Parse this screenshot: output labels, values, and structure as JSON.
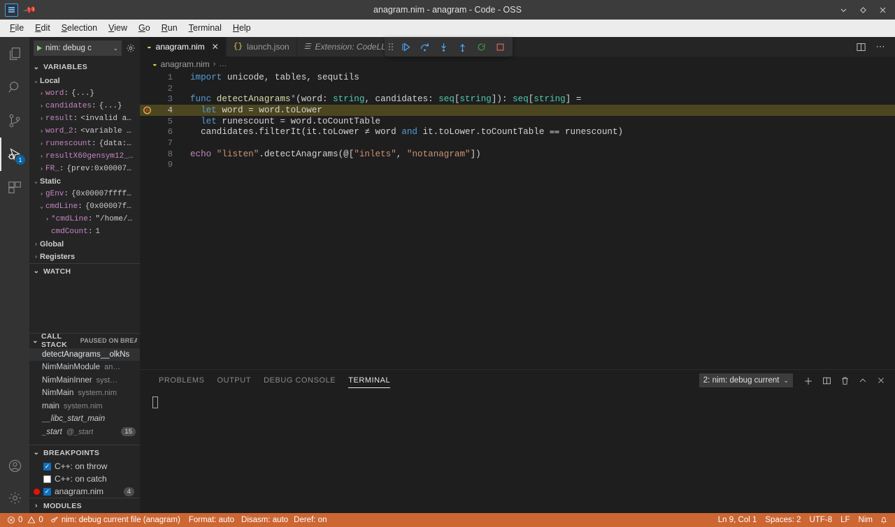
{
  "titlebar": {
    "title": "anagram.nim - anagram - Code - OSS",
    "logo_icon": "vscode-logo-icon",
    "pin_icon": "pin-icon",
    "minimize_icon": "chevron-down-icon",
    "maximize_icon": "diamond-restore-icon",
    "close_icon": "close-icon"
  },
  "menubar": {
    "items": [
      {
        "label": "File",
        "mnemonic": "F"
      },
      {
        "label": "Edit",
        "mnemonic": "E"
      },
      {
        "label": "Selection",
        "mnemonic": "S"
      },
      {
        "label": "View",
        "mnemonic": "V"
      },
      {
        "label": "Go",
        "mnemonic": "G"
      },
      {
        "label": "Run",
        "mnemonic": "R"
      },
      {
        "label": "Terminal",
        "mnemonic": "T"
      },
      {
        "label": "Help",
        "mnemonic": "H"
      }
    ]
  },
  "activitybar": {
    "items": [
      {
        "name": "explorer",
        "icon": "files-icon",
        "active": false,
        "badge": ""
      },
      {
        "name": "search",
        "icon": "search-icon",
        "active": false,
        "badge": ""
      },
      {
        "name": "source-control",
        "icon": "source-control-icon",
        "active": false,
        "badge": ""
      },
      {
        "name": "run-and-debug",
        "icon": "run-and-debug-icon",
        "active": true,
        "badge": "1"
      },
      {
        "name": "extensions",
        "icon": "extensions-icon",
        "active": false,
        "badge": ""
      }
    ],
    "bottom": [
      {
        "name": "accounts",
        "icon": "account-icon"
      },
      {
        "name": "manage",
        "icon": "gear-icon"
      }
    ]
  },
  "sidebar": {
    "launch_config": "nim: debug c",
    "launch_play_icon": "play-icon",
    "launch_chevron_icon": "chevron-down-icon",
    "gear_icon": "gear-icon",
    "variables": {
      "title": "VARIABLES",
      "rows": [
        {
          "indent": 1,
          "caret": "down",
          "name": "Local",
          "sep": "",
          "value": "",
          "group": true
        },
        {
          "indent": 2,
          "caret": "right",
          "name": "word",
          "sep": ":",
          "value": "{...}",
          "group": false
        },
        {
          "indent": 2,
          "caret": "right",
          "name": "candidates",
          "sep": ":",
          "value": "{...}",
          "group": false
        },
        {
          "indent": 2,
          "caret": "right",
          "name": "result",
          "sep": ":",
          "value": "<invalid a…",
          "group": false
        },
        {
          "indent": 2,
          "caret": "right",
          "name": "word_2",
          "sep": ":",
          "value": "<variable …",
          "group": false
        },
        {
          "indent": 2,
          "caret": "right",
          "name": "runescount",
          "sep": ":",
          "value": "{data:…",
          "group": false
        },
        {
          "indent": 2,
          "caret": "right",
          "name": "resultX60gensym12_…",
          "sep": "",
          "value": "",
          "group": false
        },
        {
          "indent": 2,
          "caret": "right",
          "name": "FR_",
          "sep": ":",
          "value": "{prev:0x00007…",
          "group": false
        },
        {
          "indent": 1,
          "caret": "down",
          "name": "Static",
          "sep": "",
          "value": "",
          "group": true
        },
        {
          "indent": 2,
          "caret": "right",
          "name": "gEnv",
          "sep": ":",
          "value": "{0x00007ffff…",
          "group": false
        },
        {
          "indent": 2,
          "caret": "down",
          "name": "cmdLine",
          "sep": ":",
          "value": "{0x00007f…",
          "group": false
        },
        {
          "indent": 3,
          "caret": "right",
          "name": "*cmdLine",
          "sep": ":",
          "value": "\"/home/…",
          "group": false
        },
        {
          "indent": 3,
          "caret": "none",
          "name": "cmdCount",
          "sep": ":",
          "value": "1",
          "group": false,
          "numeric": true
        },
        {
          "indent": 1,
          "caret": "right",
          "name": "Global",
          "sep": "",
          "value": "",
          "group": true
        },
        {
          "indent": 1,
          "caret": "right",
          "name": "Registers",
          "sep": "",
          "value": "",
          "group": true
        }
      ]
    },
    "watch": {
      "title": "WATCH"
    },
    "callstack": {
      "title": "CALL STACK",
      "subtitle": "PAUSED ON BREAKPOI",
      "frames": [
        {
          "fn": "detectAnagrams__olkNs",
          "src": "",
          "count": "",
          "selected": true,
          "italic": false
        },
        {
          "fn": "NimMainModule",
          "src": "an…",
          "count": "",
          "selected": false,
          "italic": false
        },
        {
          "fn": "NimMainInner",
          "src": "syst…",
          "count": "",
          "selected": false,
          "italic": false
        },
        {
          "fn": "NimMain",
          "src": "system.nim",
          "count": "",
          "selected": false,
          "italic": false
        },
        {
          "fn": "main",
          "src": "system.nim",
          "count": "",
          "selected": false,
          "italic": false
        },
        {
          "fn": "__libc_start_main",
          "src": "",
          "count": "",
          "selected": false,
          "italic": true
        },
        {
          "fn": "_start",
          "src": "@_start",
          "count": "15",
          "selected": false,
          "italic": true
        }
      ]
    },
    "breakpoints": {
      "title": "BREAKPOINTS",
      "items": [
        {
          "label": "C++: on throw",
          "checked": true,
          "dot": false,
          "count": ""
        },
        {
          "label": "C++: on catch",
          "checked": false,
          "dot": false,
          "count": ""
        },
        {
          "label": "anagram.nim",
          "checked": true,
          "dot": true,
          "count": "4"
        }
      ]
    },
    "modules": {
      "title": "MODULES"
    }
  },
  "editor": {
    "tabs": [
      {
        "label": "anagram.nim",
        "icon": "nim-file-icon",
        "active": true,
        "italic": false,
        "closable": true
      },
      {
        "label": "launch.json",
        "icon": "json-file-icon",
        "active": false,
        "italic": false,
        "closable": false
      },
      {
        "label": "Extension: CodeLLD",
        "icon": "markdown-file-icon",
        "active": false,
        "italic": true,
        "closable": false
      }
    ],
    "actions": [
      {
        "name": "split-editor-right",
        "icon": "split-editor-icon"
      },
      {
        "name": "more-actions",
        "icon": "ellipsis-icon"
      }
    ],
    "debug_toolbar": [
      {
        "name": "drag-handle",
        "icon": "grip-icon"
      },
      {
        "name": "continue",
        "icon": "continue-icon"
      },
      {
        "name": "step-over",
        "icon": "step-over-icon"
      },
      {
        "name": "step-into",
        "icon": "step-into-icon"
      },
      {
        "name": "step-out",
        "icon": "step-out-icon"
      },
      {
        "name": "restart",
        "icon": "restart-icon"
      },
      {
        "name": "stop",
        "icon": "stop-icon"
      }
    ],
    "breadcrumb": {
      "file": "anagram.nim",
      "separator": "›",
      "tail": "…",
      "icon": "nim-file-icon"
    },
    "highlight_line": 4,
    "breakpoint_line": 4,
    "lines": [
      {
        "n": 1,
        "tokens": [
          {
            "t": "import ",
            "c": "kw"
          },
          {
            "t": "unicode, tables, sequtils",
            "c": "def"
          }
        ]
      },
      {
        "n": 2,
        "tokens": []
      },
      {
        "n": 3,
        "tokens": [
          {
            "t": "func ",
            "c": "kw"
          },
          {
            "t": "detectAnagrams",
            "c": "fn"
          },
          {
            "t": "*",
            "c": "kw2"
          },
          {
            "t": "(word: ",
            "c": "def"
          },
          {
            "t": "string",
            "c": "type"
          },
          {
            "t": ", candidates: ",
            "c": "def"
          },
          {
            "t": "seq",
            "c": "type"
          },
          {
            "t": "[",
            "c": "def"
          },
          {
            "t": "string",
            "c": "type"
          },
          {
            "t": "]): ",
            "c": "def"
          },
          {
            "t": "seq",
            "c": "type"
          },
          {
            "t": "[",
            "c": "def"
          },
          {
            "t": "string",
            "c": "type"
          },
          {
            "t": "] =",
            "c": "def"
          }
        ]
      },
      {
        "n": 4,
        "tokens": [
          {
            "t": "  ",
            "c": "def"
          },
          {
            "t": "let ",
            "c": "kw"
          },
          {
            "t": "word = word.toLower",
            "c": "def"
          }
        ]
      },
      {
        "n": 5,
        "tokens": [
          {
            "t": "  ",
            "c": "def"
          },
          {
            "t": "let ",
            "c": "kw"
          },
          {
            "t": "runescount = word.toCountTable",
            "c": "def"
          }
        ]
      },
      {
        "n": 6,
        "tokens": [
          {
            "t": "  candidates.filterIt(it.toLower ≠ word ",
            "c": "def"
          },
          {
            "t": "and",
            "c": "kw"
          },
          {
            "t": " it.toLower.toCountTable ⩵ runescount)",
            "c": "def"
          }
        ]
      },
      {
        "n": 7,
        "tokens": []
      },
      {
        "n": 8,
        "tokens": [
          {
            "t": "echo ",
            "c": "kw2"
          },
          {
            "t": "\"listen\"",
            "c": "str"
          },
          {
            "t": ".detectAnagrams(@[",
            "c": "def"
          },
          {
            "t": "\"inlets\"",
            "c": "str"
          },
          {
            "t": ", ",
            "c": "def"
          },
          {
            "t": "\"notanagram\"",
            "c": "str"
          },
          {
            "t": "])",
            "c": "def"
          }
        ]
      },
      {
        "n": 9,
        "tokens": []
      }
    ]
  },
  "panel": {
    "tabs": [
      {
        "label": "PROBLEMS",
        "active": false
      },
      {
        "label": "OUTPUT",
        "active": false
      },
      {
        "label": "DEBUG CONSOLE",
        "active": false
      },
      {
        "label": "TERMINAL",
        "active": true
      }
    ],
    "terminal_select": "2: nim: debug current",
    "terminal_chevron_icon": "chevron-down-icon",
    "actions": [
      {
        "name": "new-terminal",
        "icon": "plus-icon"
      },
      {
        "name": "split-terminal",
        "icon": "split-icon"
      },
      {
        "name": "kill-terminal",
        "icon": "trash-icon"
      },
      {
        "name": "maximize-panel",
        "icon": "chevron-up-icon"
      },
      {
        "name": "close-panel",
        "icon": "close-icon"
      }
    ]
  },
  "statusbar": {
    "errors_icon": "error-icon",
    "errors": "0",
    "warnings_icon": "warning-icon",
    "warnings": "0",
    "debug_icon": "debug-session-icon",
    "debug_session": "nim: debug current file (anagram)",
    "format": "Format: auto",
    "disasm": "Disasm: auto",
    "deref": "Deref: on",
    "position": "Ln 9, Col 1",
    "spaces": "Spaces: 2",
    "encoding": "UTF-8",
    "eol": "LF",
    "language": "Nim",
    "bell_icon": "bell-icon",
    "background": "#cc6633"
  }
}
